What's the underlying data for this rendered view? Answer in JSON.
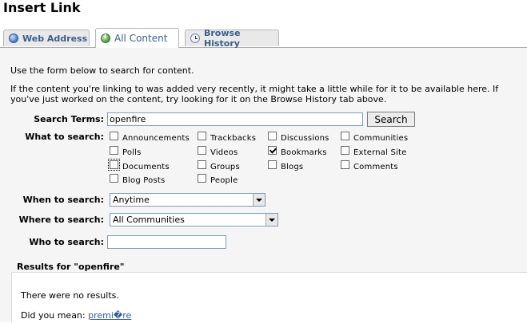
{
  "title": "Insert Link",
  "tabs": [
    {
      "label": "Web Address",
      "icon": "globe-icon",
      "active": false
    },
    {
      "label": "All Content",
      "icon": "info-icon",
      "active": true
    },
    {
      "label": "Browse History",
      "icon": "clock-icon",
      "active": false
    }
  ],
  "intro": "Use the form below to search for content.",
  "note_line1": "If the content you're linking to was added very recently, it might take a little while for it to be available here. If",
  "note_line2": "you've just worked on the content, try looking for it on the Browse History tab above.",
  "search": {
    "terms_label": "Search Terms:",
    "terms_value": "openfire",
    "button_label": "Search",
    "what_label": "What to search:",
    "types": [
      {
        "label": "Announcements",
        "checked": false
      },
      {
        "label": "Trackbacks",
        "checked": false
      },
      {
        "label": "Discussions",
        "checked": false
      },
      {
        "label": "Communities",
        "checked": false
      },
      {
        "label": "Polls",
        "checked": false
      },
      {
        "label": "Videos",
        "checked": false
      },
      {
        "label": "Bookmarks",
        "checked": true
      },
      {
        "label": "External Site",
        "checked": false
      },
      {
        "label": "Documents",
        "checked": false
      },
      {
        "label": "Groups",
        "checked": false
      },
      {
        "label": "Blogs",
        "checked": false
      },
      {
        "label": "Comments",
        "checked": false
      },
      {
        "label": "Blog Posts",
        "checked": false
      },
      {
        "label": "People",
        "checked": false
      }
    ],
    "when_label": "When to search:",
    "when_value": "Anytime",
    "where_label": "Where to search:",
    "where_value": "All Communities",
    "who_label": "Who to search:",
    "who_value": ""
  },
  "results": {
    "heading": "Results for \"openfire\"",
    "none": "There were no results.",
    "did_you_mean": "Did you mean:",
    "suggestion": "premi�re"
  }
}
